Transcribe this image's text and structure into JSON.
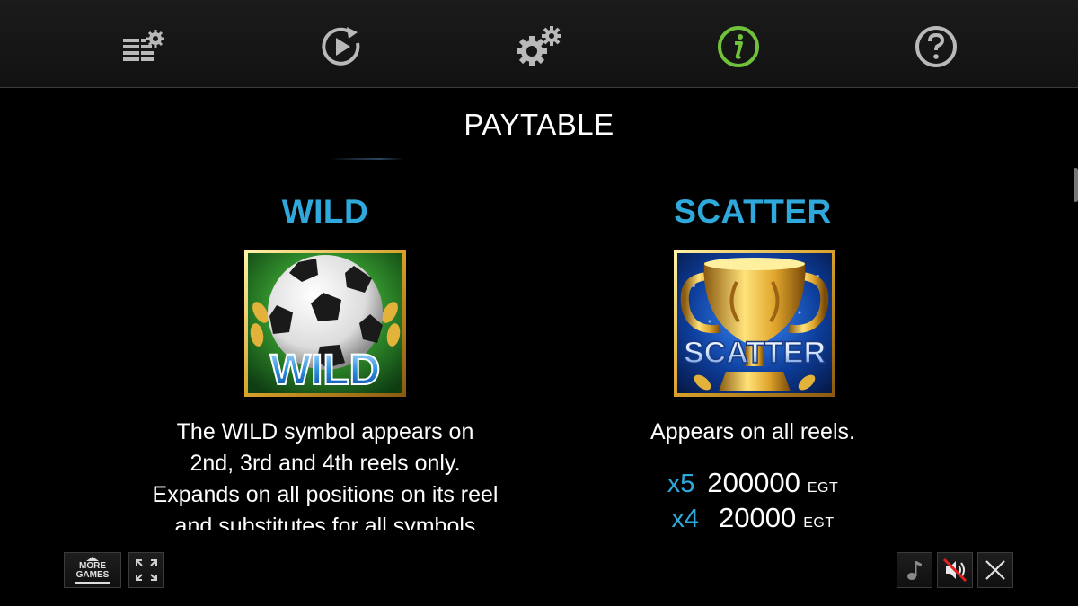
{
  "nav": {
    "items": [
      {
        "id": "bet-settings",
        "icon": "bet-settings-icon"
      },
      {
        "id": "autoplay",
        "icon": "autoplay-icon"
      },
      {
        "id": "settings",
        "icon": "gears-icon"
      },
      {
        "id": "info",
        "icon": "info-icon",
        "active": true
      },
      {
        "id": "help",
        "icon": "help-icon"
      }
    ]
  },
  "colors": {
    "accent": "#2fa9dc",
    "active_icon": "#6fc23a",
    "icon": "#b9b9b9"
  },
  "page_title": "PAYTABLE",
  "wild": {
    "title": "WILD",
    "symbol_text": "WILD",
    "description_lines": [
      "The WILD symbol appears on",
      "2nd, 3rd and 4th reels only.",
      "Expands on all positions on its reel",
      "and substitutes for all symbols"
    ]
  },
  "scatter": {
    "title": "SCATTER",
    "symbol_text": "SCATTER",
    "description": "Appears on all reels.",
    "payouts": [
      {
        "mult": "x5",
        "value": "200000",
        "currency": "EGT"
      },
      {
        "mult": "x4",
        "value": "20000",
        "currency": "EGT"
      }
    ]
  },
  "bottom": {
    "more_games_line1": "MORE",
    "more_games_line2": "GAMES"
  }
}
